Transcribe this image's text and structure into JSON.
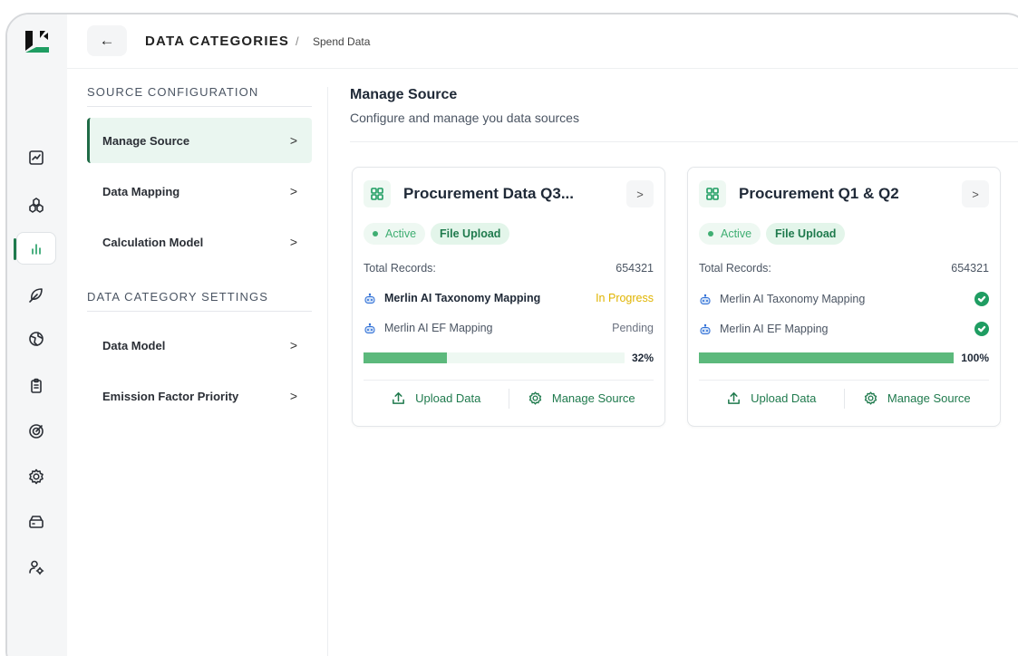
{
  "breadcrumb": {
    "back_icon": "arrow-left-icon",
    "title": "DATA CATEGORIES",
    "separator": "/",
    "current": "Spend Data"
  },
  "rail": {
    "icons": [
      "chart-line-icon",
      "cubes-icon",
      "bar-chart-icon",
      "leaf-icon",
      "globe-icon",
      "clipboard-icon",
      "target-icon",
      "gear-icon",
      "hard-drive-icon",
      "user-settings-icon"
    ],
    "active": "bar-chart-icon"
  },
  "nav": {
    "source_heading": "SOURCE CONFIGURATION",
    "source_items": [
      {
        "label": "Manage Source",
        "active": true
      },
      {
        "label": "Data Mapping"
      },
      {
        "label": "Calculation Model"
      }
    ],
    "settings_heading": "DATA CATEGORY SETTINGS",
    "settings_items": [
      {
        "label": "Data Model"
      },
      {
        "label": "Emission Factor Priority"
      }
    ],
    "chevron": ">"
  },
  "main": {
    "title": "Manage Source",
    "description": "Configure and manage you data sources"
  },
  "cards": [
    {
      "title": "Procurement Data Q3...",
      "status": "Active",
      "type": "File Upload",
      "records_label": "Total Records:",
      "records_value": "654321",
      "taxonomy_label": "Merlin AI Taxonomy Mapping",
      "taxonomy_status": "In Progress",
      "ef_label": "Merlin AI EF Mapping",
      "ef_status": "Pending",
      "progress": 0.32,
      "progress_label": "32%",
      "upload_label": "Upload Data",
      "manage_label": "Manage Source",
      "chevron": ">"
    },
    {
      "title": "Procurement Q1 & Q2",
      "status": "Active",
      "type": "File Upload",
      "records_label": "Total Records:",
      "records_value": "654321",
      "taxonomy_label": "Merlin AI Taxonomy Mapping",
      "taxonomy_status": "complete",
      "ef_label": "Merlin AI EF Mapping",
      "ef_status": "complete",
      "progress": 1.0,
      "progress_label": "100%",
      "upload_label": "Upload Data",
      "manage_label": "Manage Source",
      "chevron": ">"
    }
  ],
  "colors": {
    "accent": "#1f9d62",
    "progress_fill": "#5cb97c",
    "in_progress": "#e0b400"
  }
}
